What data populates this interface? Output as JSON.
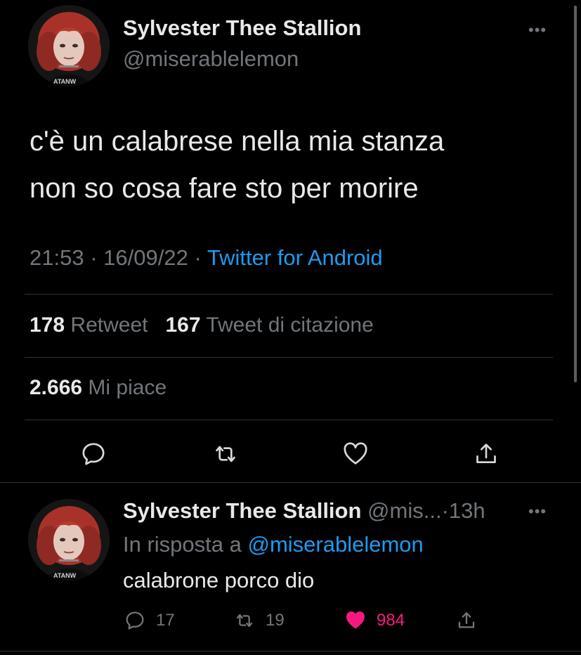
{
  "tweet": {
    "author": {
      "name": "Sylvester Thee Stallion",
      "handle": "@miserablelemon"
    },
    "more_label": "•••",
    "text_lines": [
      "c'è un calabrese nella mia stanza",
      "non so cosa fare sto per morire"
    ],
    "time": "21:53",
    "date": "16/09/22",
    "separator": "·",
    "source": "Twitter for Android",
    "stats": {
      "retweets": "178",
      "retweets_label": "Retweet",
      "quotes": "167",
      "quotes_label": "Tweet di citazione",
      "likes": "2.666",
      "likes_label": "Mi piace"
    },
    "actions": [
      "reply-icon",
      "retweet-icon",
      "like-icon",
      "share-icon"
    ]
  },
  "reply": {
    "author": {
      "name": "Sylvester Thee Stallion",
      "handle": "@mis...",
      "time": "13h"
    },
    "separator": "·",
    "more_label": "•••",
    "replying_to_label": "In risposta a",
    "replying_to_handle": "@miserablelemon",
    "text": "calabrone porco dio",
    "counts": {
      "replies": "17",
      "retweets": "19",
      "likes": "984"
    },
    "liked": true
  },
  "colors": {
    "background": "#000000",
    "text": "#e7e9ea",
    "secondary": "#71767b",
    "link": "#1d9bf0",
    "like": "#f91880",
    "divider": "#2f3336"
  }
}
